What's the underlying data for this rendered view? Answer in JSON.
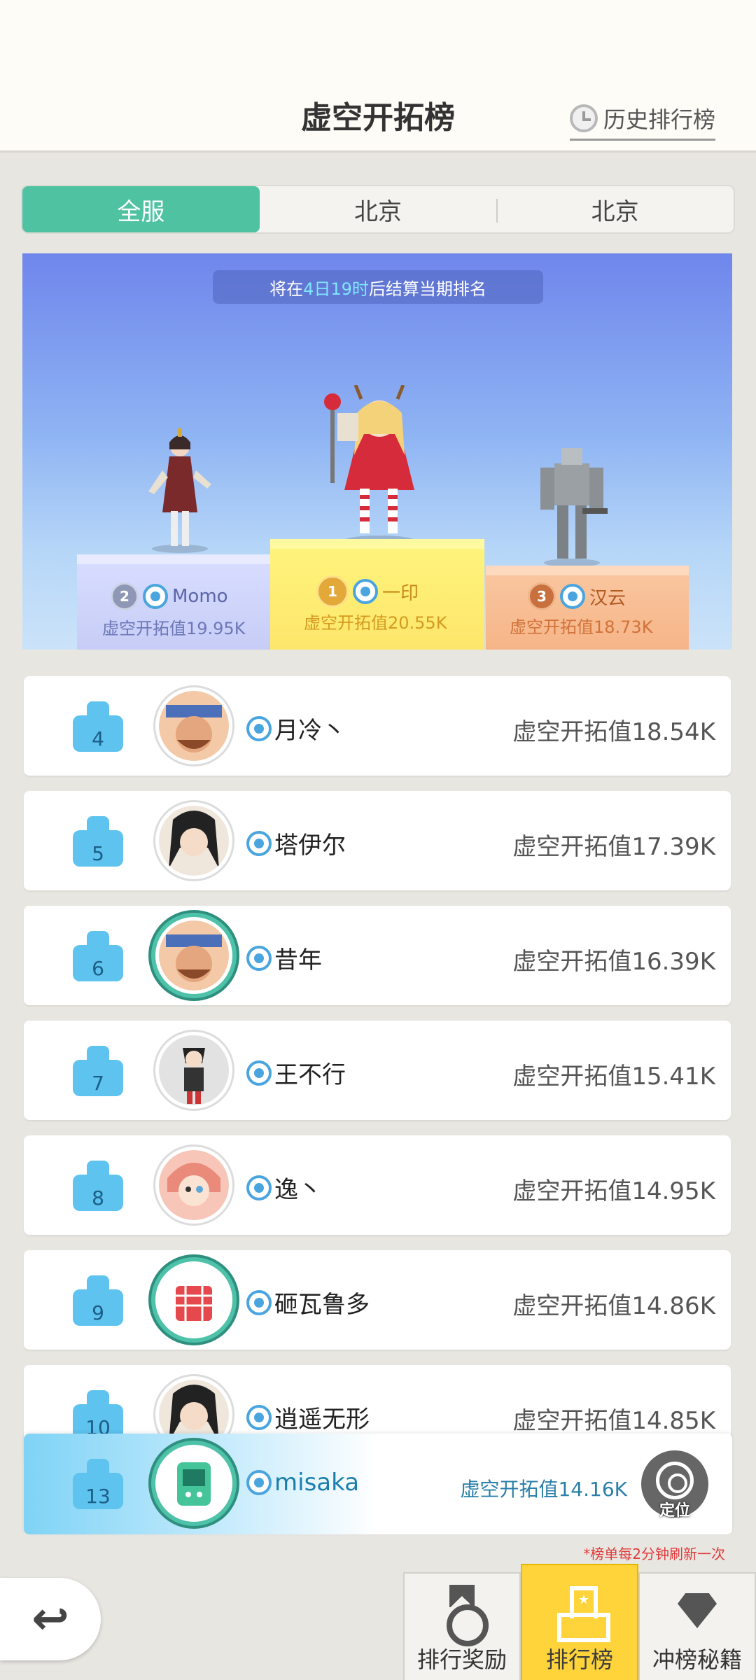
{
  "header": {
    "title": "虚空开拓榜",
    "history_label": "历史排行榜"
  },
  "tabs": [
    "全服",
    "北京",
    "北京"
  ],
  "notice": {
    "prefix": "将在",
    "highlight": "4日19时",
    "suffix": "后结算当期排名"
  },
  "podium": {
    "first": {
      "rank": "1",
      "name": "一印",
      "score": "虚空开拓值20.55K"
    },
    "second": {
      "rank": "2",
      "name": "Momo",
      "score": "虚空开拓值19.95K"
    },
    "third": {
      "rank": "3",
      "name": "汉云",
      "score": "虚空开拓值18.73K"
    }
  },
  "rows": [
    {
      "rank": "4",
      "name": "月冷丶",
      "score": "虚空开拓值18.54K"
    },
    {
      "rank": "5",
      "name": "塔伊尔",
      "score": "虚空开拓值17.39K"
    },
    {
      "rank": "6",
      "name": "昔年",
      "score": "虚空开拓值16.39K"
    },
    {
      "rank": "7",
      "name": "王不行",
      "score": "虚空开拓值15.41K"
    },
    {
      "rank": "8",
      "name": "逸丶",
      "score": "虚空开拓值14.95K"
    },
    {
      "rank": "9",
      "name": "砸瓦鲁多",
      "score": "虚空开拓值14.86K"
    },
    {
      "rank": "10",
      "name": "逍遥无形",
      "score": "虚空开拓值14.85K"
    }
  ],
  "me": {
    "rank": "13",
    "name": "misaka",
    "score": "虚空开拓值14.16K",
    "locate_label": "定位"
  },
  "refresh_note": "*榜单每2分钟刷新一次",
  "nav": [
    {
      "label": "排行奖励",
      "icon": "medal-icon"
    },
    {
      "label": "排行榜",
      "icon": "podium-icon"
    },
    {
      "label": "冲榜秘籍",
      "icon": "diamond-icon"
    }
  ],
  "colors": {
    "accent": "#4fc3a1",
    "nav_active": "#ffd43b",
    "rank_badge": "#5ec3ef"
  }
}
